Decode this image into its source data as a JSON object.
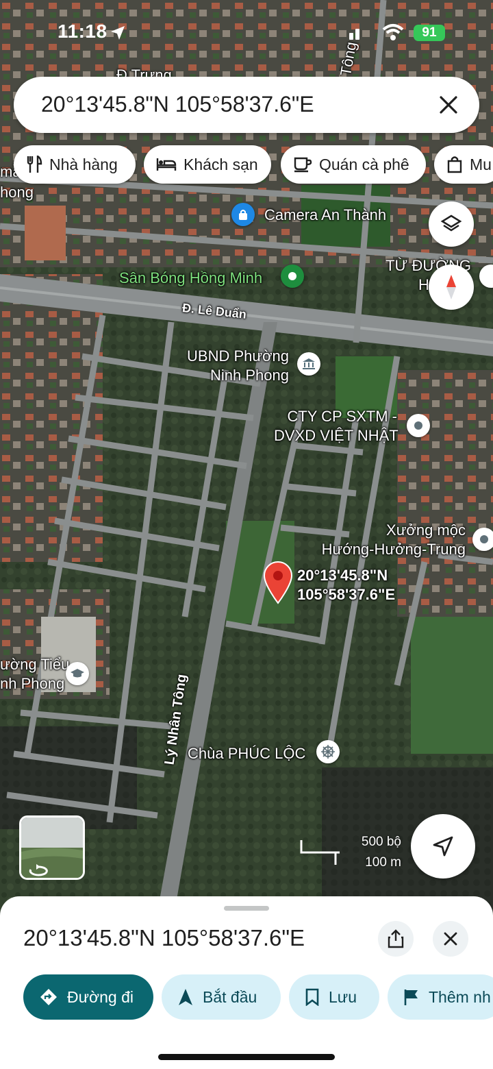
{
  "status_bar": {
    "time": "11:18",
    "battery": "91"
  },
  "search": {
    "query": "20°13'45.8\"N 105°58'37.6\"E"
  },
  "chips": [
    {
      "label": "Nhà hàng",
      "icon": "restaurant-icon"
    },
    {
      "label": "Khách sạn",
      "icon": "hotel-icon"
    },
    {
      "label": "Quán cà phê",
      "icon": "coffee-icon"
    },
    {
      "label": "Mu",
      "icon": "shopping-bag-icon"
    }
  ],
  "map": {
    "street_top": "Đ Trưng",
    "street_top_right": "Tông",
    "camera": "Camera An Thành",
    "stadium": "Sân Bóng Hồng Minh",
    "church_l1": "TỪ ĐƯỜNG",
    "church_l2": "HỌ (VŨ",
    "road_le_duan": "Đ. Lê Duẩn",
    "ubnd_l1": "UBND Phường",
    "ubnd_l2": "Ninh Phong",
    "company_l1": "CTY CP SXTM -",
    "company_l2": "DVXD VIỆT NHẬT",
    "workshop_l1": "Xưởng mộc",
    "workshop_l2": "Hướng-Hưởng-Trung",
    "pin_l1": "20°13'45.8\"N",
    "pin_l2": "105°58'37.6\"E",
    "school_l1": "ường Tiểu",
    "school_l2": "nh Phong",
    "road_ly_nhan_tong": "Lý Nhân Tông",
    "pagoda": "Chùa PHÚC LỘC",
    "left_top_l1": "mầ",
    "left_top_l2": "hong",
    "scale_ft": "500 bộ",
    "scale_m": "100 m"
  },
  "sheet": {
    "title": "20°13'45.8\"N 105°58'37.6\"E",
    "actions": [
      {
        "label": "Đường đi",
        "icon": "directions-icon"
      },
      {
        "label": "Bắt đầu",
        "icon": "navigation-arrow-icon"
      },
      {
        "label": "Lưu",
        "icon": "bookmark-icon"
      },
      {
        "label": "Thêm nh",
        "icon": "flag-icon"
      }
    ]
  },
  "colors": {
    "primary": "#0b6770",
    "secondary": "#d7f0f8",
    "pin": "#ea4335"
  }
}
